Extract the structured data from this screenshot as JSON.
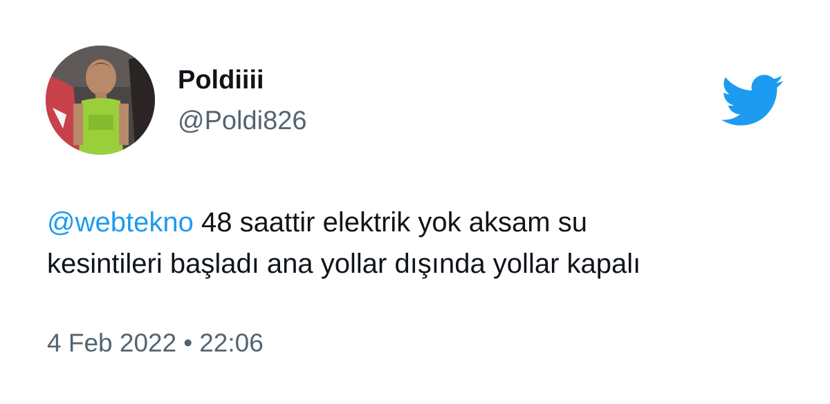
{
  "user": {
    "display_name": "Poldiiii",
    "handle": "@Poldi826"
  },
  "tweet": {
    "mention": "@webtekno",
    "line1": " 48 saattir elektrik yok aksam su",
    "line2": "kesintileri başladı ana yollar dışında yollar kapalı"
  },
  "meta": {
    "date": "4 Feb 2022",
    "separator": "•",
    "time": "22:06"
  },
  "icons": {
    "brand": "twitter-bird-icon"
  },
  "colors": {
    "brand": "#1d9bf0",
    "text": "#0f1419",
    "secondary": "#536471"
  }
}
